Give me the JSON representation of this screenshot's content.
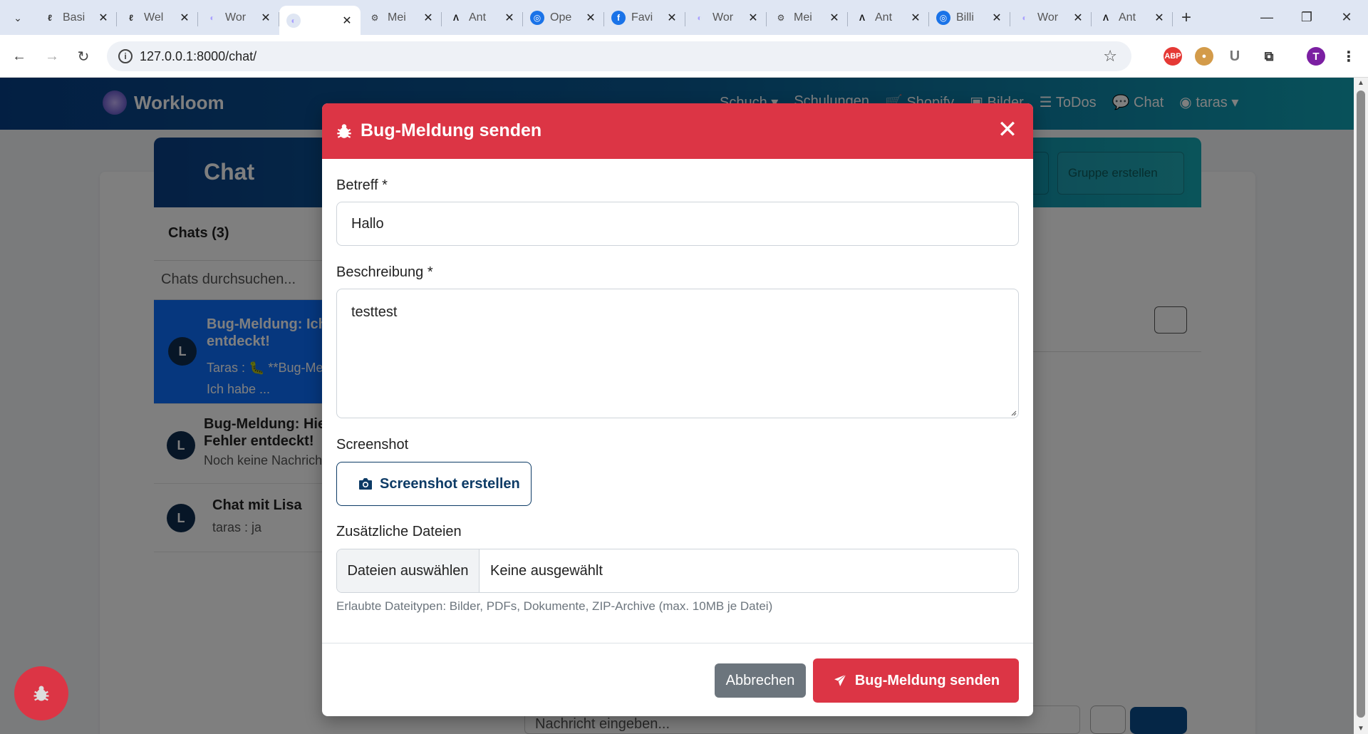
{
  "browser": {
    "tabs": [
      {
        "title": "Basi",
        "fav": "feather"
      },
      {
        "title": "Wel",
        "fav": "feather"
      },
      {
        "title": "Wor",
        "fav": "spinner"
      },
      {
        "title": "",
        "fav": "spinner",
        "active": true
      },
      {
        "title": "Mei",
        "fav": "gear"
      },
      {
        "title": "Ant",
        "fav": "anthropic"
      },
      {
        "title": "Ope",
        "fav": "openai"
      },
      {
        "title": "Favi",
        "fav": "f"
      },
      {
        "title": "Wor",
        "fav": "spinner"
      },
      {
        "title": "Mei",
        "fav": "gear"
      },
      {
        "title": "Ant",
        "fav": "anthropic"
      },
      {
        "title": "Billi",
        "fav": "openai"
      },
      {
        "title": "Wor",
        "fav": "spinner"
      },
      {
        "title": "Ant",
        "fav": "anthropic"
      }
    ],
    "url": "127.0.0.1:8000/chat/",
    "profile_initial": "T"
  },
  "app": {
    "brand": "Workloom",
    "nav": [
      "Schuch ▾",
      "Schulungen",
      "Shopify",
      "Bilder",
      "ToDos",
      "Chat"
    ],
    "user": "taras",
    "page_title": "Chat",
    "create_group": "Gruppe erstellen",
    "chats_count": "Chats (3)",
    "search_placeholder": "Chats durchsuchen...",
    "chats": [
      {
        "initial": "L",
        "name": "Bug-Meldung: Ich… entdeckt!",
        "name1": "Bug-Meldung: Ich",
        "name2": "entdeckt!",
        "preview1": "Taras : 🐛 **Bug-Mel",
        "preview2": "Ich habe ..."
      },
      {
        "initial": "L",
        "name1": "Bug-Meldung: Hie",
        "name2": "Fehler entdeckt!",
        "preview1": "Noch keine Nachricht"
      },
      {
        "initial": "L",
        "name1": "Chat mit Lisa",
        "preview1": "taras : ja"
      }
    ],
    "composer_placeholder": "Nachricht eingeben..."
  },
  "modal": {
    "title": "Bug-Meldung senden",
    "subject_label": "Betreff *",
    "subject_value": "Hallo",
    "description_label": "Beschreibung *",
    "description_value": "testtest",
    "screenshot_label": "Screenshot",
    "screenshot_button": "Screenshot erstellen",
    "files_label": "Zusätzliche Dateien",
    "files_button": "Dateien auswählen",
    "files_none": "Keine ausgewählt",
    "files_hint": "Erlaubte Dateitypen: Bilder, PDFs, Dokumente, ZIP-Archive (max. 10MB je Datei)",
    "cancel": "Abbrechen",
    "submit": "Bug-Meldung senden"
  },
  "colors": {
    "danger": "#dc3545",
    "primary": "#0d6efd",
    "secondary": "#6c757d",
    "navy": "#0d3b66"
  }
}
